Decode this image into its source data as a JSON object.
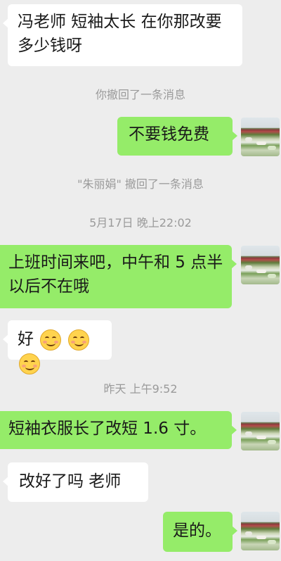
{
  "messages": [
    {
      "from": "them",
      "text": "冯老师 短袖太长 在你那改要多少钱呀"
    },
    {
      "type": "system",
      "text": "你撤回了一条消息"
    },
    {
      "from": "me",
      "text": "不要钱免费"
    },
    {
      "type": "system",
      "text": "\"朱丽娟\" 撤回了一条消息"
    },
    {
      "type": "time",
      "text": "5月17日 晚上22:02"
    },
    {
      "from": "me",
      "text": "上班时间来吧，中午和 5 点半以后不在哦"
    },
    {
      "from": "them",
      "text": "好",
      "emoji": [
        "smile-blush-emoji",
        "smile-blush-emoji",
        "smile-blush-emoji"
      ]
    },
    {
      "type": "time",
      "text": "昨天 上午9:52"
    },
    {
      "from": "me",
      "text": "短袖衣服长了改短 1.6 寸。"
    },
    {
      "from": "them",
      "text": "改好了吗 老师"
    },
    {
      "from": "me",
      "text": "是的。"
    }
  ],
  "colors": {
    "background": "#ededed",
    "outgoing_bubble": "#95ec69",
    "incoming_bubble": "#ffffff",
    "system_text": "#9a9a9a"
  },
  "icons": {
    "avatar": "user-avatar-tulip-field"
  }
}
